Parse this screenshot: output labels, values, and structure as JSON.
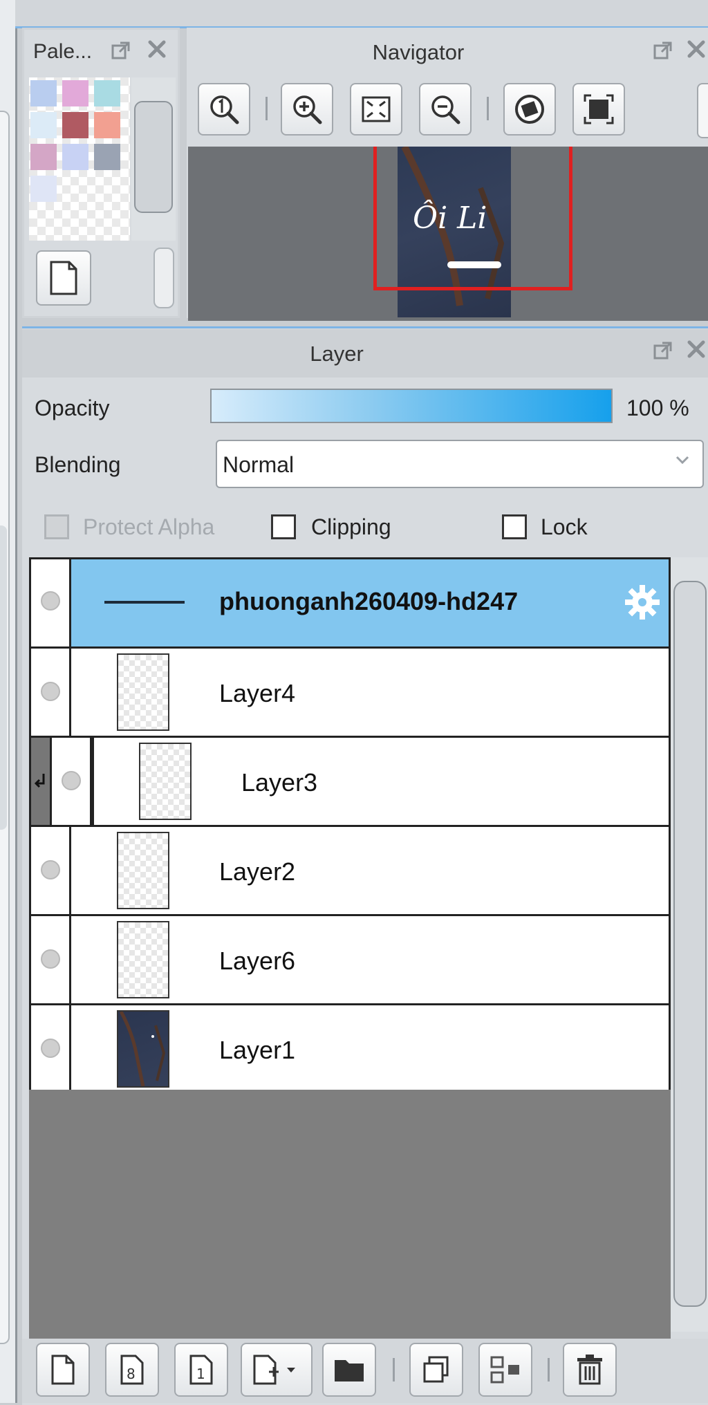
{
  "palette": {
    "title": "Pale...",
    "swatches": [
      "#b9cdef",
      "#e2a9d9",
      "#a9dbe3",
      "#dcebf7",
      "#b05a62",
      "#f2a091",
      "#d4a6c6",
      "#c8d2f4",
      "#9aa3b3",
      "#dfe5f6"
    ]
  },
  "navigator": {
    "title": "Navigator"
  },
  "layer_panel": {
    "title": "Layer",
    "opacity_label": "Opacity",
    "opacity_value": "100 %",
    "opacity_fraction": 1.0,
    "blending_label": "Blending",
    "blending_value": "Normal",
    "protect_alpha_label": "Protect Alpha",
    "clipping_label": "Clipping",
    "lock_label": "Lock",
    "layers": [
      {
        "name": "phuonganh260409-hd247",
        "selected": true
      },
      {
        "name": "Layer4"
      },
      {
        "name": "Layer3",
        "clipped": true
      },
      {
        "name": "Layer2"
      },
      {
        "name": "Layer6"
      },
      {
        "name": "Layer1"
      }
    ]
  },
  "accent": "#82c6ef",
  "icons": [
    "float-icon",
    "close-icon",
    "zoom-actual-icon",
    "zoom-in-icon",
    "fit-icon",
    "zoom-out-icon",
    "rotate-icon",
    "fullscreen-icon",
    "new-page-icon",
    "settings-gear-icon",
    "new-layer-icon",
    "new-8bit-layer-icon",
    "new-1bit-layer-icon",
    "add-layer-menu-icon",
    "folder-icon",
    "duplicate-icon",
    "merge-down-icon",
    "delete-icon"
  ]
}
